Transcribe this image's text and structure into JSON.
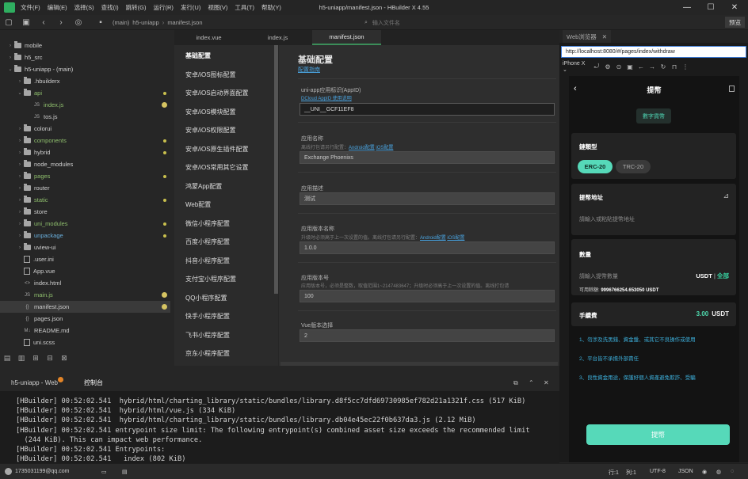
{
  "window": {
    "title": "h5-uniapp/manifest.json - HBuilder X 4.55"
  },
  "menu": [
    "文件(F)",
    "编辑(E)",
    "选择(S)",
    "查找(I)",
    "跳转(G)",
    "运行(R)",
    "发行(U)",
    "视图(V)",
    "工具(T)",
    "帮助(Y)"
  ],
  "window_controls": {
    "minimize": "—",
    "maximize": "☐",
    "close": "✕"
  },
  "toolbar": {
    "crumb_prefix": "(main)",
    "crumb_project": "h5-uniapp",
    "crumb_file": "manifest.json",
    "search_placeholder": "输入文件名",
    "preview_label": "预览"
  },
  "tree": [
    {
      "label": "mobile",
      "type": "folder",
      "arrow": "›",
      "indent": 0,
      "tone": "",
      "marker": ""
    },
    {
      "label": "h5_src",
      "type": "folder",
      "arrow": "›",
      "indent": 0,
      "tone": "",
      "marker": ""
    },
    {
      "label": "h5-uniapp - (main)",
      "type": "folder",
      "arrow": "⌄",
      "indent": 0,
      "tone": "",
      "marker": ""
    },
    {
      "label": ".hbuilderx",
      "type": "folder",
      "arrow": "›",
      "indent": 1,
      "tone": "",
      "marker": ""
    },
    {
      "label": "api",
      "type": "folder",
      "arrow": "⌄",
      "indent": 1,
      "tone": "green",
      "marker": "dot"
    },
    {
      "label": "index.js",
      "type": "js",
      "arrow": "",
      "indent": 2,
      "tone": "green",
      "marker": "badge"
    },
    {
      "label": "tos.js",
      "type": "js",
      "arrow": "",
      "indent": 2,
      "tone": "",
      "marker": ""
    },
    {
      "label": "colorui",
      "type": "folder",
      "arrow": "›",
      "indent": 1,
      "tone": "",
      "marker": ""
    },
    {
      "label": "components",
      "type": "folder",
      "arrow": "›",
      "indent": 1,
      "tone": "green",
      "marker": "dot"
    },
    {
      "label": "hybrid",
      "type": "folder",
      "arrow": "›",
      "indent": 1,
      "tone": "",
      "marker": "dot"
    },
    {
      "label": "node_modules",
      "type": "folder",
      "arrow": "›",
      "indent": 1,
      "tone": "",
      "marker": ""
    },
    {
      "label": "pages",
      "type": "folder",
      "arrow": "›",
      "indent": 1,
      "tone": "green",
      "marker": "dot"
    },
    {
      "label": "router",
      "type": "folder",
      "arrow": "›",
      "indent": 1,
      "tone": "",
      "marker": ""
    },
    {
      "label": "static",
      "type": "folder",
      "arrow": "›",
      "indent": 1,
      "tone": "green",
      "marker": "dot"
    },
    {
      "label": "store",
      "type": "folder",
      "arrow": "›",
      "indent": 1,
      "tone": "",
      "marker": ""
    },
    {
      "label": "uni_modules",
      "type": "folder",
      "arrow": "›",
      "indent": 1,
      "tone": "green",
      "marker": "dot"
    },
    {
      "label": "unpackage",
      "type": "folder",
      "arrow": "›",
      "indent": 1,
      "tone": "blue",
      "marker": "dot"
    },
    {
      "label": "uview-ui",
      "type": "folder",
      "arrow": "›",
      "indent": 1,
      "tone": "",
      "marker": ""
    },
    {
      "label": ".user.ini",
      "type": "file",
      "arrow": "",
      "indent": 1,
      "tone": "",
      "marker": ""
    },
    {
      "label": "App.vue",
      "type": "file",
      "arrow": "",
      "indent": 1,
      "tone": "",
      "marker": ""
    },
    {
      "label": "index.html",
      "type": "html",
      "arrow": "",
      "indent": 1,
      "tone": "",
      "marker": ""
    },
    {
      "label": "main.js",
      "type": "js",
      "arrow": "",
      "indent": 1,
      "tone": "green",
      "marker": "badge"
    },
    {
      "label": "manifest.json",
      "type": "json",
      "arrow": "",
      "indent": 1,
      "tone": "",
      "marker": "badge",
      "selected": true
    },
    {
      "label": "pages.json",
      "type": "json",
      "arrow": "",
      "indent": 1,
      "tone": "",
      "marker": ""
    },
    {
      "label": "README.md",
      "type": "md",
      "arrow": "",
      "indent": 1,
      "tone": "",
      "marker": ""
    },
    {
      "label": "uni.scss",
      "type": "file",
      "arrow": "",
      "indent": 1,
      "tone": "",
      "marker": ""
    }
  ],
  "file_type_glyphs": {
    "js": "JS",
    "json": "{}",
    "html": "<>",
    "md": "M↓"
  },
  "tabs": [
    {
      "label": "index.vue",
      "active": false
    },
    {
      "label": "index.js",
      "active": false
    },
    {
      "label": "manifest.json",
      "active": true
    }
  ],
  "settings_nav": [
    "基础配置",
    "安卓/iOS图标配置",
    "安卓/iOS启动界面配置",
    "安卓/iOS模块配置",
    "安卓/iOS权限配置",
    "安卓/iOS原生插件配置",
    "安卓/iOS常用其它设置",
    "鸿蒙App配置",
    "Web配置",
    "微信小程序配置",
    "百度小程序配置",
    "抖音小程序配置",
    "支付宝小程序配置",
    "QQ小程序配置",
    "快手小程序配置",
    "飞书小程序配置",
    "京东小程序配置"
  ],
  "form": {
    "title": "基础配置",
    "subtitle": "配置指南",
    "appid": {
      "label": "uni-app应用标识(AppID)",
      "hint_link": "DCloud AppID 使用说明",
      "value": "__UNI__GCF11EF8"
    },
    "appname": {
      "label": "应用名称",
      "hint": "离线打包请另行配置：",
      "hint_link1": "Android配置",
      "hint_link2": "iOS配置",
      "value": "Exchange Phoenixs"
    },
    "desc": {
      "label": "应用描述",
      "value": "测试"
    },
    "version_name": {
      "label": "应用版本名称",
      "hint": "升级时必须高于上一次设置的值。离线打包请另行配置：",
      "hint_link1": "Android配置",
      "hint_link2": "iOS配置",
      "value": "1.0.0"
    },
    "version_code": {
      "label": "应用版本号",
      "hint": "应用版本号，必须是整数，取值范围1~2147483647；升级时必须高于上一次设置的值。离线打包请",
      "value": "100"
    },
    "vue": {
      "label": "Vue版本选择",
      "value": "2"
    }
  },
  "browser": {
    "tab_label": "Web浏览器",
    "tab_close": "✕",
    "url": "http://localhost:8080/#/pages/index/withdraw",
    "device": "iPhone X"
  },
  "phone": {
    "title": "提幣",
    "currency_button": "數字貨幣",
    "chain_label": "鏈類型",
    "chain_options": [
      "ERC-20",
      "TRC-20"
    ],
    "address_label": "提幣地址",
    "address_placeholder": "請輸入或粘貼提幣地址",
    "amount_label": "數量",
    "amount_placeholder": "請輸入提幣數量",
    "amount_unit": "USDT",
    "amount_sep": "|",
    "amount_all": "全部",
    "available_label": "可用餘額:",
    "available_value": "9996766254.653050 USDT",
    "fee_label": "手續費",
    "fee_value": "3.00",
    "fee_unit": "USDT",
    "notes": [
      "1、勿涉及洗黑錢、資金盤、或其它不良操作或使用",
      "2、平台皆不承擔外部責任",
      "3、良性資金用途，保護好個人資產避免欺詐、受騙"
    ],
    "submit_label": "提幣"
  },
  "console": {
    "project_tab": "h5-uniapp - Web",
    "console_tab": "控制台",
    "lines": [
      "[HBuilder] 00:52:02.541  hybrid/html/charting_library/static/bundles/library.d8f5cc7dfd69730985ef782d21a1321f.css (517 KiB)",
      "[HBuilder] 00:52:02.541  hybrid/html/vue.js (334 KiB)",
      "[HBuilder] 00:52:02.541  hybrid/html/charting_library/static/bundles/library.db04e45ec22f0b637da3.js (2.12 MiB)",
      "[HBuilder] 00:52:02.541 entrypoint size limit: The following entrypoint(s) combined asset size exceeds the recommended limit",
      "  (244 KiB). This can impact web performance.",
      "[HBuilder] 00:52:02.541 Entrypoints:",
      "[HBuilder] 00:52:02.541   index (802 KiB)"
    ]
  },
  "status": {
    "user": "1735031199@qq.com",
    "line": "行:1",
    "col": "列:1",
    "encoding": "UTF-8",
    "language": "JSON"
  }
}
